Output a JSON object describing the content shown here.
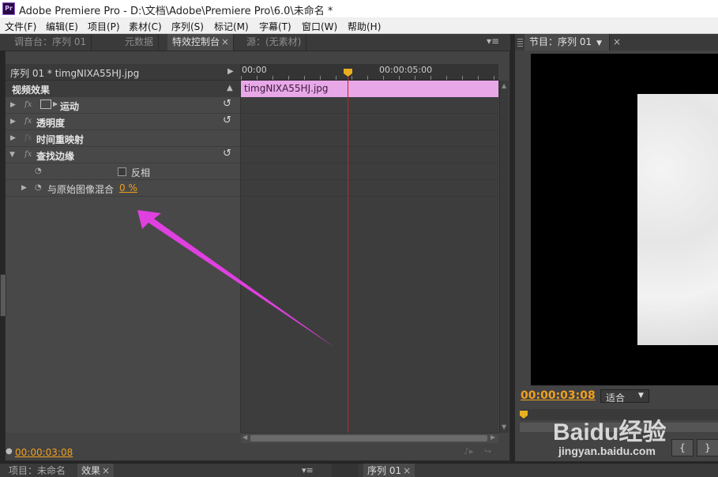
{
  "window": {
    "app_icon": "Pr",
    "title": "Adobe Premiere Pro - D:\\文档\\Adobe\\Premiere Pro\\6.0\\未命名 *"
  },
  "menu": [
    "文件(F)",
    "编辑(E)",
    "项目(P)",
    "素材(C)",
    "序列(S)",
    "标记(M)",
    "字幕(T)",
    "窗口(W)",
    "帮助(H)"
  ],
  "top_panel": {
    "tabs": [
      "调音台：序列 01",
      "元数据",
      "特效控制台",
      "源：(无素材)"
    ],
    "active_tab": "特效控制台",
    "close_glyph": "×",
    "menu_glyph": "≡"
  },
  "effect_controls": {
    "clip_path": "序列 01 * timgNIXA55HJ.jpg",
    "section_label": "视频效果",
    "effects": [
      {
        "name": "运动",
        "has_reset": true
      },
      {
        "name": "透明度",
        "has_reset": true
      },
      {
        "name": "时间重映射",
        "has_reset": false
      },
      {
        "name": "查找边缘",
        "has_reset": true
      }
    ],
    "params": {
      "invert_label": "反相",
      "blend_label": "与原始图像混合",
      "blend_value": "0 %"
    },
    "timeline": {
      "start_time": "00:00",
      "mid_time": "00:00:05:00",
      "clip_name": "timgNIXA55HJ.jpg"
    },
    "current_time": "00:00:03:08",
    "icons": [
      "triangle-right-icon",
      "triangle-down-icon",
      "fx-icon",
      "reset-icon",
      "stopwatch-icon"
    ]
  },
  "program": {
    "tab_label": "节目：序列 01",
    "timecode": "00:00:03:08",
    "fit_label": "适合",
    "tool_buttons": [
      "{",
      "}"
    ]
  },
  "bottom": {
    "tabs": [
      "项目：未命名",
      "效果",
      "序列 01"
    ]
  },
  "watermark": {
    "logo": "Baidu经验",
    "url": "jingyan.baidu.com"
  },
  "colors": {
    "clip_bar": "#e8a8e8",
    "timecode": "#f0a020",
    "playhead": "#d02020",
    "annotation_arrow": "#e040e0"
  }
}
